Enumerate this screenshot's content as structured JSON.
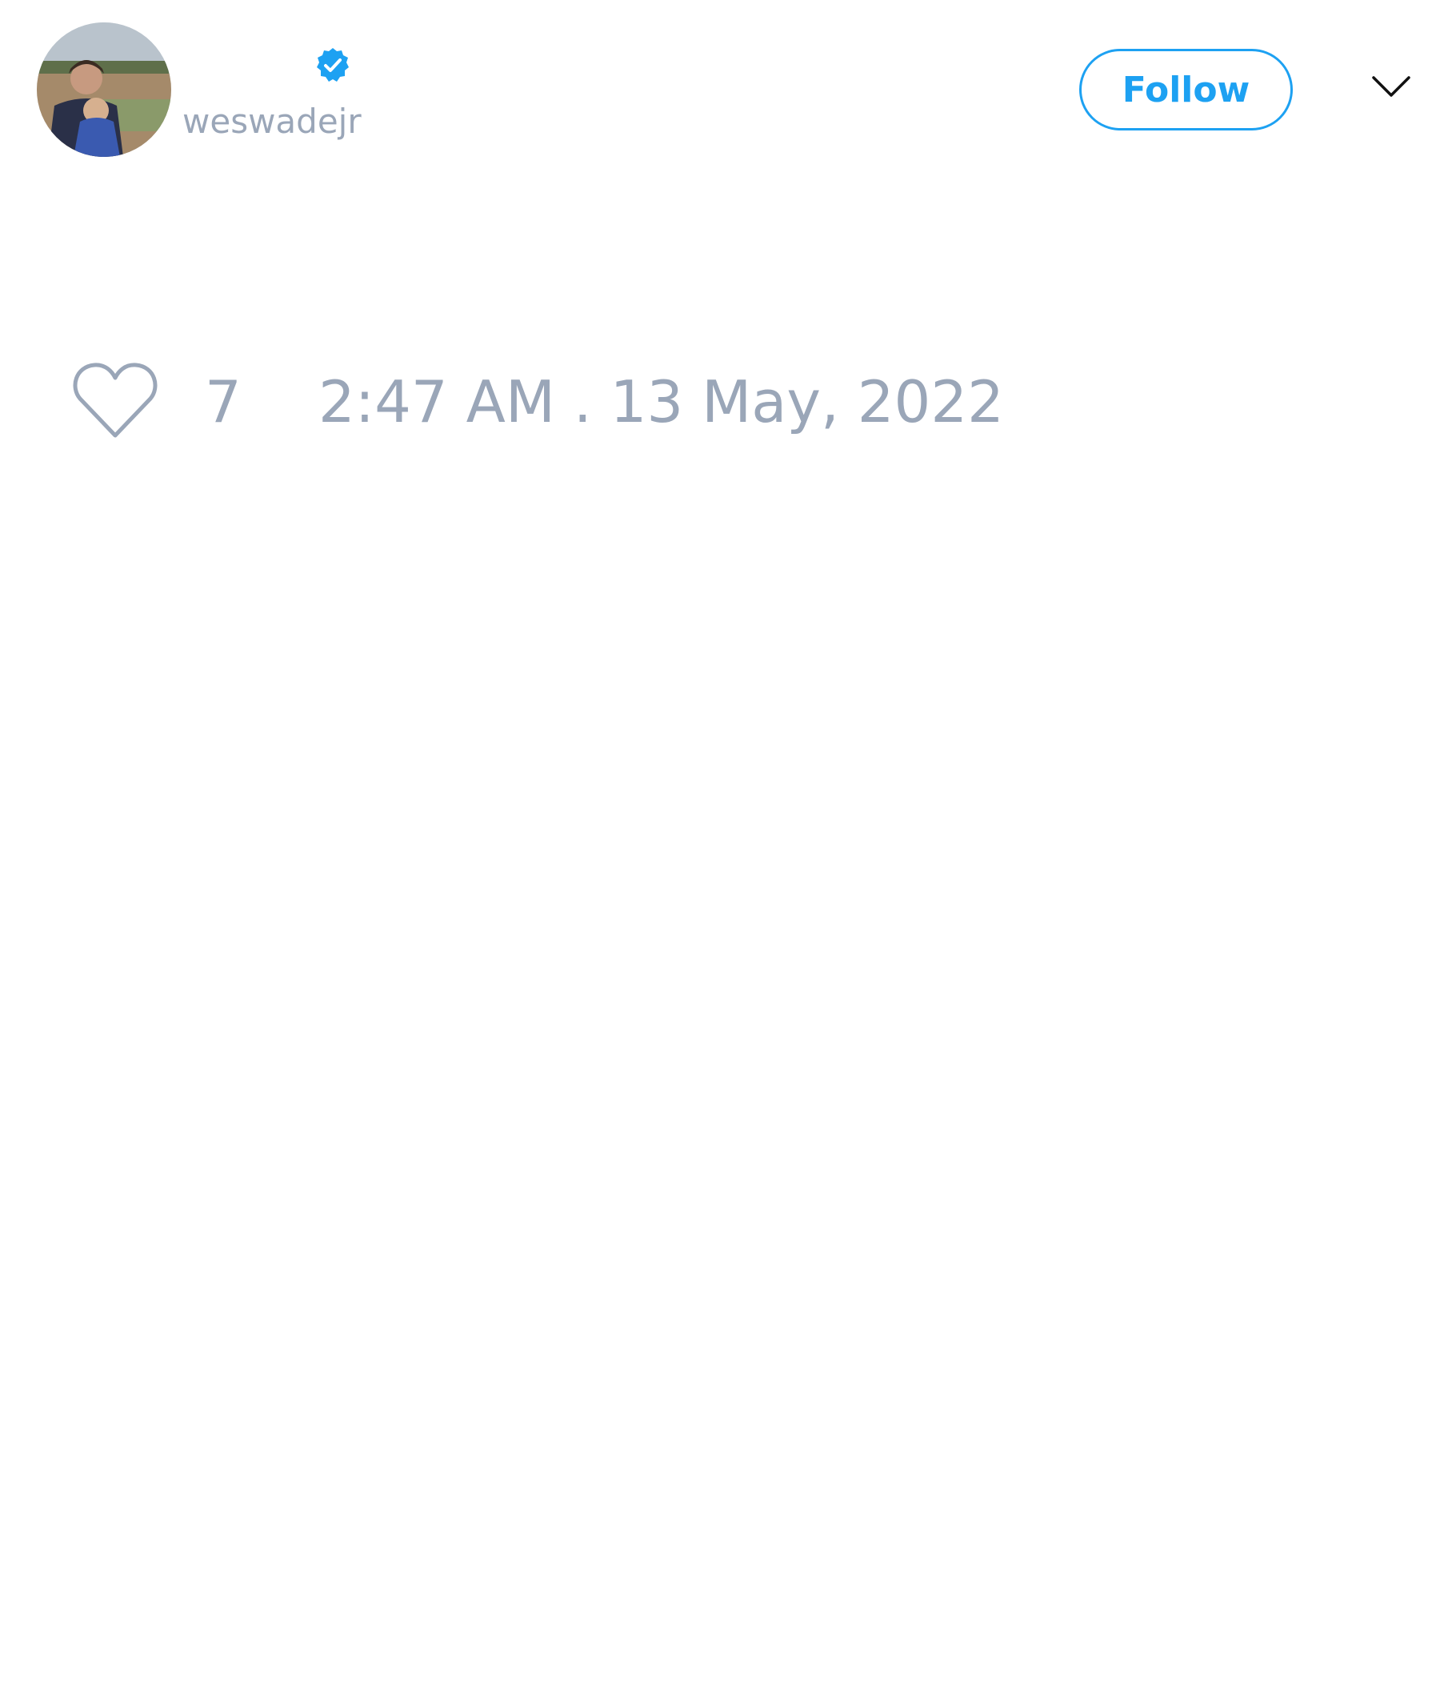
{
  "author": {
    "handle": "weswadejr",
    "verified": true,
    "avatar_icon": "profile-photo-icon"
  },
  "header": {
    "follow_label": "Follow",
    "menu_icon": "chevron-down-icon"
  },
  "stats": {
    "like_icon": "heart-outline-icon",
    "likes": "7",
    "timestamp": "2:47 AM . 13 May, 2022"
  },
  "colors": {
    "accent": "#1da1f2",
    "muted_text": "#9aa6b8",
    "background": "#ffffff"
  }
}
